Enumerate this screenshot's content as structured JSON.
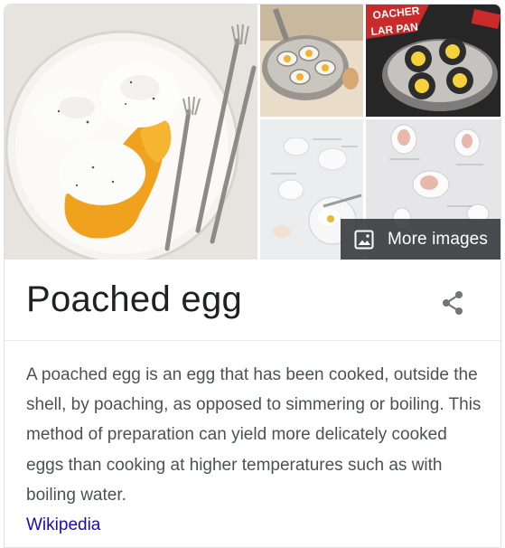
{
  "gallery": {
    "images": [
      {
        "icon": "poached-eggs-plate-image"
      },
      {
        "icon": "egg-poacher-pan-image"
      },
      {
        "icon": "poacher-pan-box-image"
      },
      {
        "icon": "poaching-steps-image"
      },
      {
        "icon": "poaching-stages-image"
      }
    ],
    "pan_box_text_top": "OACHER",
    "pan_box_text_bottom": "LAR PAN",
    "more_images_label": "More images"
  },
  "entity": {
    "title": "Poached egg",
    "description": "A poached egg is an egg that has been cooked, outside the shell, by poaching, as opposed to simmering or boiling. This method of preparation can yield more delicately cooked eggs than cooking at higher temperatures such as with boiling water.",
    "source_label": "Wikipedia"
  },
  "colors": {
    "title_text": "#202124",
    "body_text": "#4d5156",
    "link": "#1a0dab",
    "icon": "#70757a",
    "overlay": "#303134"
  }
}
